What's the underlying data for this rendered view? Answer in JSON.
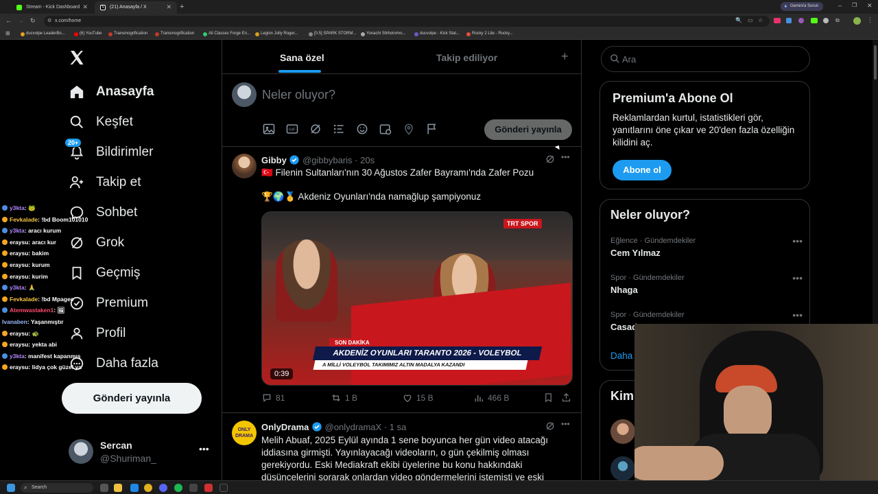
{
  "browser": {
    "tabs": [
      {
        "title": "Stream - Kick Dashboard",
        "color": "#53fc18"
      },
      {
        "title": "(21) Anasayfa / X",
        "color": "#ffffff"
      }
    ],
    "url": "x.com/home",
    "gemini_label": "Gemini'a Sorun",
    "bookmarks": [
      {
        "label": "ducvolpe LeaderBo...",
        "color": "#e8a020"
      },
      {
        "label": "(6) YouTube",
        "color": "#ff0000"
      },
      {
        "label": "Transmogrification",
        "color": "#c0392b"
      },
      {
        "label": "Transmogrification",
        "color": "#c0392b"
      },
      {
        "label": "All Classes Forge En...",
        "color": "#2ecc71"
      },
      {
        "label": "Legion Jolly Roger...",
        "color": "#d4a017"
      },
      {
        "label": "[0.5] SPARK STORM...",
        "color": "#888888"
      },
      {
        "label": "Yonachi Shihoin#vo...",
        "color": "#aaaaaa"
      },
      {
        "label": "ducvolpe - Kick Stat...",
        "color": "#6a5acd"
      },
      {
        "label": "Rocky 2 Lite - Rocky...",
        "color": "#e74c3c"
      }
    ]
  },
  "nav": {
    "items": [
      {
        "label": "Anasayfa",
        "icon": "home-icon"
      },
      {
        "label": "Keşfet",
        "icon": "search-icon"
      },
      {
        "label": "Bildirimler",
        "icon": "bell-icon",
        "badge": "20+"
      },
      {
        "label": "Takip et",
        "icon": "add-user-icon"
      },
      {
        "label": "Sohbet",
        "icon": "chat-icon"
      },
      {
        "label": "Grok",
        "icon": "grok-icon"
      },
      {
        "label": "Geçmiş",
        "icon": "bookmark-icon"
      },
      {
        "label": "Premium",
        "icon": "verified-icon"
      },
      {
        "label": "Profil",
        "icon": "profile-icon"
      },
      {
        "label": "Daha fazla",
        "icon": "more-icon"
      }
    ],
    "post_button": "Gönderi yayınla",
    "account": {
      "name": "Sercan",
      "handle": "@Shuriman_"
    }
  },
  "feed": {
    "tabs": [
      "Sana özel",
      "Takip ediliyor"
    ],
    "composer": {
      "placeholder": "Neler oluyor?",
      "submit": "Gönderi yayınla"
    },
    "tweets": [
      {
        "author": "Gibby",
        "handle": "@gibbybaris",
        "time": "· 20s",
        "text1": "🇹🇷 Filenin Sultanları'nın 30 Ağustos Zafer Bayramı'nda Zafer Pozu",
        "text2": "🏆🌍🥇 Akdeniz Oyunları'nda namağlup şampiyonuz",
        "media": {
          "duration": "0:39",
          "breaking": "SON DAKİKA",
          "headline": "AKDENİZ OYUNLARI TARANTO 2026 - VOLEYBOL",
          "subline": "A MİLLİ VOLEYBOL TAKIMIMIZ ALTIN MADALYA KAZANDI",
          "channel": "TRT SPOR"
        },
        "stats": {
          "replies": "81",
          "reposts": "1 B",
          "likes": "15 B",
          "views": "466 B"
        }
      },
      {
        "author": "OnlyDrama",
        "handle": "@onlydramaX",
        "time": "· 1 sa",
        "avatar_text": "ONLY DRAMA",
        "text": "Melih Abuaf, 2025 Eylül ayında 1 sene boyunca her gün video atacağı iddiasına girmişti. Yayınlayacağı videoların, o gün çekilmiş olması gerekiyordu. Eski Mediakraft ekibi üyelerine bu konu hakkındaki düşüncelerini sorarak onlardan video göndermelerini istemişti ve eski"
      }
    ]
  },
  "sidebar": {
    "search_placeholder": "Ara",
    "premium": {
      "title": "Premium'a Abone Ol",
      "body": "Reklamlardan kurtul, istatistikleri gör, yanıtlarını öne çıkar ve 20'den fazla özelliğin kilidini aç.",
      "button": "Abone ol"
    },
    "trends_title": "Neler oluyor?",
    "trends": [
      {
        "category": "Eğlence · Gündemdekiler",
        "name": "Cem Yılmaz"
      },
      {
        "category": "Spor · Gündemdekiler",
        "name": "Nhaga"
      },
      {
        "category": "Spor · Gündemdekiler",
        "name": "Casad"
      }
    ],
    "show_more": "Daha",
    "who_to_follow": "Kim"
  },
  "chat": [
    {
      "user": "y3kta",
      "msg": ": 🐸",
      "color": "#b388ff",
      "badge": "#4a90e2"
    },
    {
      "user": "Fevkalade",
      "msg": ": !bd Boom101010",
      "color": "#f5c542",
      "badge": "#f5a623"
    },
    {
      "user": "y3kta",
      "msg": ": aracı kurum",
      "color": "#b388ff",
      "badge": "#4a90e2"
    },
    {
      "user": "eraysu",
      "msg": ": aracı kur",
      "color": "#ffffff",
      "badge": "#f5a623"
    },
    {
      "user": "eraysu",
      "msg": ": bakim",
      "color": "#ffffff",
      "badge": "#f5a623"
    },
    {
      "user": "eraysu",
      "msg": ": kurum",
      "color": "#ffffff",
      "badge": "#f5a623"
    },
    {
      "user": "eraysu",
      "msg": ": kurim",
      "color": "#ffffff",
      "badge": "#f5a623"
    },
    {
      "user": "y3kta",
      "msg": ": 🙏",
      "color": "#b388ff",
      "badge": "#4a90e2"
    },
    {
      "user": "Fevkalade",
      "msg": ": !bd Mpagee",
      "color": "#f5c542",
      "badge": "#f5a623"
    },
    {
      "user": "Atemwastaken1",
      "msg": ": 🖼",
      "color": "#ff4d6d",
      "badge": "#4a90e2"
    },
    {
      "user": "Ivanaben",
      "msg": ": Yaşanmıştır",
      "color": "#9ab8ff",
      "badge": ""
    },
    {
      "user": "eraysu",
      "msg": ": 🐢",
      "color": "#ffffff",
      "badge": "#f5a623"
    },
    {
      "user": "eraysu",
      "msg": ": yekta abi",
      "color": "#ffffff",
      "badge": "#f5a623"
    },
    {
      "user": "y3kta",
      "msg": ": manifest kapanmış",
      "color": "#b388ff",
      "badge": "#4a90e2"
    },
    {
      "user": "eraysu",
      "msg": ": lidya çok güzel ya",
      "color": "#ffffff",
      "badge": "#f5a623"
    }
  ],
  "taskbar": {
    "search": "Search"
  }
}
